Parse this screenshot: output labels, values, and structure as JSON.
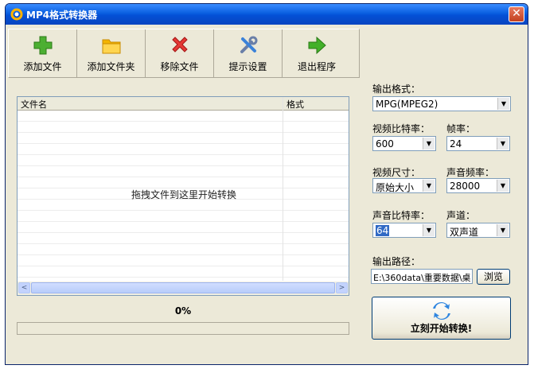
{
  "window": {
    "title": "MP4格式转换器",
    "close_label": "✕"
  },
  "toolbar": {
    "add_file": "添加文件",
    "add_folder": "添加文件夹",
    "remove_file": "移除文件",
    "settings": "提示设置",
    "exit": "退出程序"
  },
  "file_list": {
    "columns": [
      "文件名",
      "格式"
    ],
    "hint": "拖拽文件到这里开始转换",
    "scroll_left": "<",
    "scroll_right": ">"
  },
  "progress": {
    "text": "0%",
    "value": 0
  },
  "settings": {
    "output_format_label": "输出格式：",
    "output_format_value": "MPG(MPEG2)",
    "video_bitrate_label": "视频比特率：",
    "video_bitrate_value": "600",
    "frame_rate_label": "帧率：",
    "frame_rate_value": "24",
    "video_size_label": "视频尺寸：",
    "video_size_value": "原始大小",
    "audio_freq_label": "声音频率：",
    "audio_freq_value": "28000",
    "audio_bitrate_label": "声音比特率：",
    "audio_bitrate_value": "64",
    "channel_label": "声道：",
    "channel_value": "双声道",
    "output_path_label": "输出路径：",
    "output_path_value": "E:\\360data\\重要数据\\桌",
    "browse_label": "浏览",
    "start_label": "立刻开始转换!",
    "dropdown_arrow": "▼"
  },
  "colors": {
    "titlebar": "#0a5fe0",
    "window_bg": "#ece9d8",
    "selection": "#316ac5"
  }
}
